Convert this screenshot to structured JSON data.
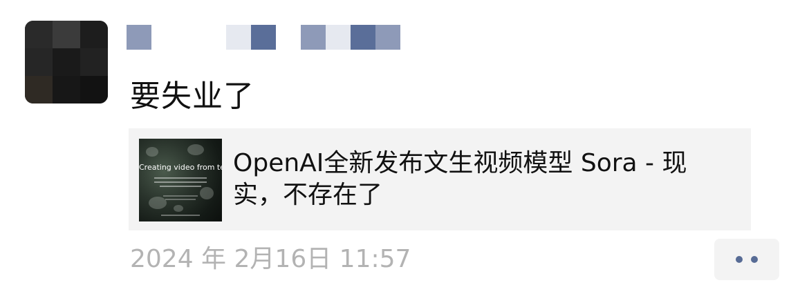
{
  "post": {
    "text": "要失业了",
    "nickname_pixels": [
      "#8e9ab8",
      "#ffffff",
      "#e6e9f0",
      "#5a6e99",
      "#8e9ab8",
      "#e6e9f0",
      "#5a6e99",
      "#8e9ab8"
    ],
    "link": {
      "title": "OpenAI全新发布文生视频模型 Sora - 现实，不存在了",
      "thumbnail": {
        "headline": "Creating video from text"
      }
    },
    "timestamp": "2024 年 2月16日 11:57",
    "more_icon": "more-dots-icon",
    "colors": {
      "link_blue": "#576b95",
      "card_bg": "#f3f3f3",
      "timestamp_gray": "#b3b3b3"
    }
  }
}
